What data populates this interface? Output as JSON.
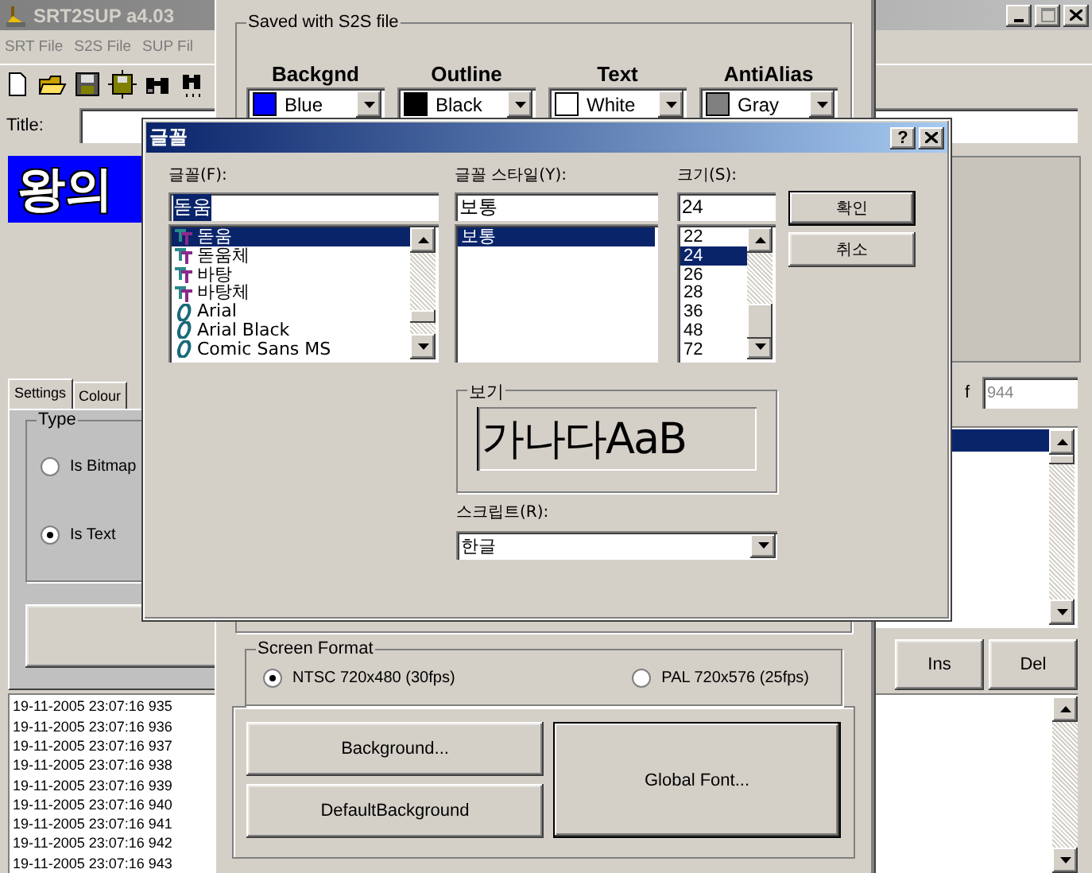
{
  "main_window": {
    "title": "SRT2SUP a4.03",
    "active": false,
    "menu": [
      {
        "label": "SRT File",
        "disabled": true
      },
      {
        "label": "S2S File",
        "disabled": true
      },
      {
        "label": "SUP Fil",
        "disabled": true
      }
    ],
    "title_label": "Title:",
    "preview_text": "왕의",
    "tabs": [
      {
        "label": "Settings",
        "selected": true
      },
      {
        "label": "Colour",
        "selected": false
      }
    ],
    "type_group": {
      "title": "Type",
      "options": [
        {
          "label": "Is Bitmap",
          "selected": false
        },
        {
          "label": "Is Text",
          "selected": true
        }
      ]
    },
    "count_label": "f",
    "count_value": "944",
    "list_rows": [
      {
        "selected": true
      }
    ],
    "buttons": [
      "Ins",
      "Del"
    ],
    "log": [
      "19-11-2005 23:07:16 935",
      "19-11-2005 23:07:16 936",
      "19-11-2005 23:07:16 937",
      "19-11-2005 23:07:16 938",
      "19-11-2005 23:07:16 939",
      "19-11-2005 23:07:16 940",
      "19-11-2005 23:07:16 941",
      "19-11-2005 23:07:16 942",
      "19-11-2005 23:07:16 943"
    ]
  },
  "colour_window": {
    "group_title": "Saved with S2S file",
    "colours": [
      {
        "heading": "Backgnd",
        "value": "Blue",
        "color": "#0000ff"
      },
      {
        "heading": "Outline",
        "value": "Black",
        "color": "#000000"
      },
      {
        "heading": "Text",
        "value": "White",
        "color": "#ffffff"
      },
      {
        "heading": "AntiAlias",
        "value": "Gray",
        "color": "#808080"
      }
    ],
    "screen_format": {
      "title": "Screen Format",
      "options": [
        {
          "label": "NTSC 720x480 (30fps)",
          "selected": true
        },
        {
          "label": "PAL 720x576 (25fps)",
          "selected": false
        }
      ]
    },
    "buttons": [
      {
        "label": "Background...",
        "default": false
      },
      {
        "label": "DefaultBackground",
        "default": false
      },
      {
        "label": "Global Font...",
        "default": true
      }
    ]
  },
  "font_dialog": {
    "title": "글꼴",
    "active": true,
    "help_button": "?",
    "font_label": "글꼴(F):",
    "font_value": "돋움",
    "font_value_selected": true,
    "fonts": [
      {
        "name": "돋움",
        "kind": "truetype",
        "selected": true
      },
      {
        "name": "돋움체",
        "kind": "truetype",
        "selected": false
      },
      {
        "name": "바탕",
        "kind": "truetype",
        "selected": false
      },
      {
        "name": "바탕체",
        "kind": "truetype",
        "selected": false
      },
      {
        "name": "Arial",
        "kind": "opentype",
        "selected": false
      },
      {
        "name": "Arial Black",
        "kind": "opentype",
        "selected": false
      },
      {
        "name": "Comic Sans MS",
        "kind": "opentype",
        "selected": false
      }
    ],
    "style_label": "글꼴 스타일(Y):",
    "style_value": "보통",
    "styles": [
      {
        "name": "보통",
        "selected": true
      }
    ],
    "size_label": "크기(S):",
    "size_value": "24",
    "sizes": [
      {
        "name": "22",
        "selected": false
      },
      {
        "name": "24",
        "selected": true
      },
      {
        "name": "26",
        "selected": false
      },
      {
        "name": "28",
        "selected": false
      },
      {
        "name": "36",
        "selected": false
      },
      {
        "name": "48",
        "selected": false
      },
      {
        "name": "72",
        "selected": false
      }
    ],
    "ok": "확인",
    "cancel": "취소",
    "preview_title": "보기",
    "preview_text": "가나다AaB",
    "script_label": "스크립트(R):",
    "script_value": "한글"
  }
}
